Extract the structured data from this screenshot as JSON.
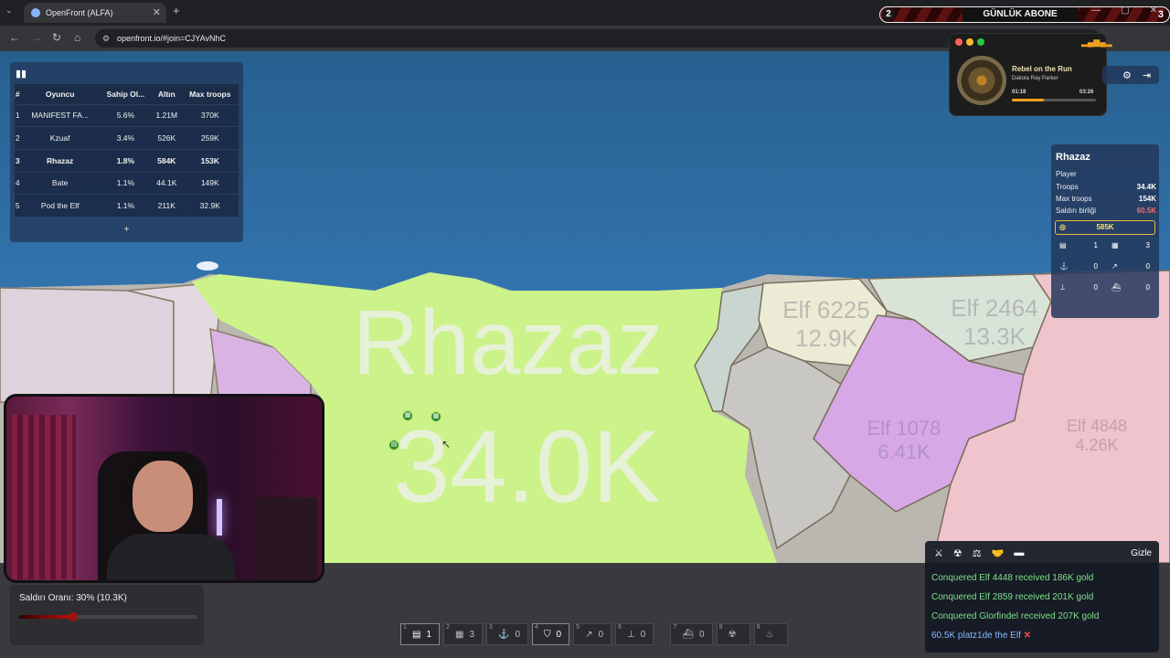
{
  "browser": {
    "tab_title": "OpenFront (ALFA)",
    "url": "openfront.io/#join=CJYAvNhC",
    "minimize": "—",
    "restore": "▢",
    "close": "✕"
  },
  "banner": {
    "left_number": "2",
    "text": "GÜNLÜK ABONE",
    "right_number": "3"
  },
  "leaderboard": {
    "headers": [
      "#",
      "Oyuncu",
      "Sahip Ol...",
      "Altın",
      "Max troops"
    ],
    "rows": [
      {
        "rank": "1",
        "player": "MANIFEST FA...",
        "owned": "5.6%",
        "gold": "1.21M",
        "troops": "370K"
      },
      {
        "rank": "2",
        "player": "Kzuaf",
        "owned": "3.4%",
        "gold": "526K",
        "troops": "259K"
      },
      {
        "rank": "3",
        "player": "Rhazaz",
        "owned": "1.8%",
        "gold": "584K",
        "troops": "153K"
      },
      {
        "rank": "4",
        "player": "Bate",
        "owned": "1.1%",
        "gold": "44.1K",
        "troops": "149K"
      },
      {
        "rank": "5",
        "player": "Pod the Elf",
        "owned": "1.1%",
        "gold": "211K",
        "troops": "32.9K"
      }
    ],
    "expand": "+"
  },
  "music": {
    "title": "Rebel on the Run",
    "artist": "Dakota Ray Parker",
    "elapsed": "01:18",
    "total": "03:26",
    "progress": 0.38
  },
  "player_info": {
    "name": "Rhazaz",
    "type": "Player",
    "troops_label": "Troops",
    "troops": "34.4K",
    "max_troops_label": "Max troops",
    "max_troops": "154K",
    "alliance_label": "Saldırı birliği",
    "alliance": "60.5K",
    "gold": "585K",
    "structures": [
      {
        "icon": "city-icon",
        "count": "1"
      },
      {
        "icon": "factory-icon",
        "count": "3"
      },
      {
        "icon": "port-icon",
        "count": "0"
      },
      {
        "icon": "missile-silo-icon",
        "count": "0"
      },
      {
        "icon": "sam-launcher-icon",
        "count": "0"
      },
      {
        "icon": "warship-icon",
        "count": "0"
      }
    ]
  },
  "map": {
    "main_name": "Rhazaz",
    "main_troops": "34.0K",
    "labels": [
      {
        "name": "Elf 6225",
        "troops": "12.9K"
      },
      {
        "name": "Elf 2464",
        "troops": "13.3K"
      },
      {
        "name": "Elf 1078",
        "troops": "6.41K"
      },
      {
        "name": "Elf 4848",
        "troops": "4.26K"
      }
    ]
  },
  "attack_ratio": {
    "label": "Saldırı Oranı: 30% (10.3K)",
    "value": 0.3
  },
  "build_bar": [
    {
      "key": "1",
      "icon": "city-icon",
      "count": "1"
    },
    {
      "key": "2",
      "icon": "factory-icon",
      "count": "3"
    },
    {
      "key": "3",
      "icon": "port-icon",
      "count": "0"
    },
    {
      "key": "4",
      "icon": "defense-post-icon",
      "count": "0"
    },
    {
      "key": "5",
      "icon": "missile-silo-icon",
      "count": "0"
    },
    {
      "key": "6",
      "icon": "sam-launcher-icon",
      "count": "0"
    },
    {
      "key": "7",
      "icon": "warship-icon",
      "count": "0"
    },
    {
      "key": "8",
      "icon": "atom-bomb-icon",
      "count": ""
    },
    {
      "key": "9",
      "icon": "hydrogen-bomb-icon",
      "count": ""
    }
  ],
  "events": {
    "hide_label": "Gizle",
    "messages": [
      "Conquered Elf 4448 received 186K gold",
      "Conquered Elf 2859 received 201K gold",
      "Conquered Glorfindel received 207K gold"
    ],
    "last_message": "60.5K platz1de the Elf"
  }
}
